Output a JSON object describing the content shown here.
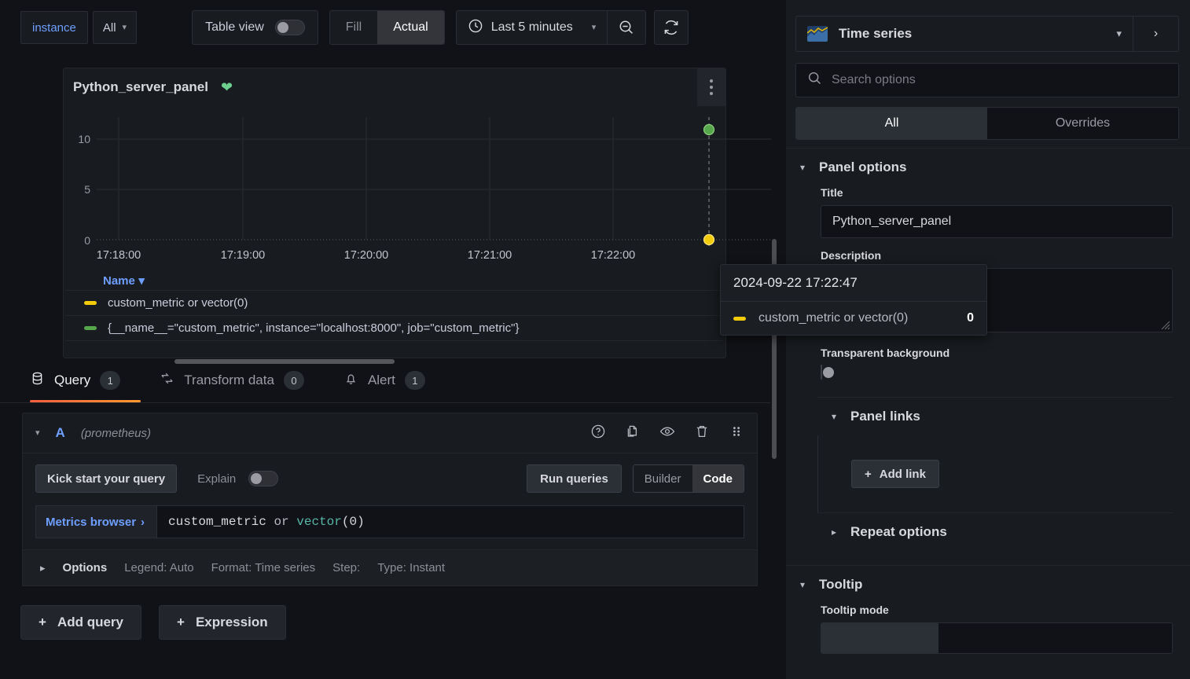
{
  "toolbar": {
    "variable_label": "instance",
    "variable_value": "All",
    "table_view_label": "Table view",
    "table_view_on": false,
    "fill_label": "Fill",
    "actual_label": "Actual",
    "fill_actual_selected": "Actual",
    "time_range": "Last 5 minutes",
    "clock_icon": "clock-icon",
    "zoom_out_icon": "zoom-out-icon",
    "refresh_icon": "refresh-icon",
    "chevron_icon": "chevron-down-icon"
  },
  "panel": {
    "title": "Python_server_panel",
    "health_icon": "heart-icon",
    "health_color": "#6ccf8e",
    "menu_icon": "kebab-menu-icon",
    "legend_sort": "Name",
    "legend": [
      {
        "label": "custom_metric or vector(0)",
        "color": "#f2cc0c"
      },
      {
        "label": "{__name__=\"custom_metric\", instance=\"localhost:8000\", job=\"custom_metric\"}",
        "color": "#56a64b"
      }
    ]
  },
  "chart_data": {
    "type": "scatter",
    "title": "Python_server_panel",
    "xlabel": "",
    "ylabel": "",
    "x_tick_labels": [
      "17:18:00",
      "17:19:00",
      "17:20:00",
      "17:21:00",
      "17:22:00"
    ],
    "y_tick_labels": [
      "0",
      "5",
      "10"
    ],
    "ylim": [
      0,
      12.5
    ],
    "grid": true,
    "legend_position": "bottom",
    "crosshair_time": "17:22:47",
    "series": [
      {
        "name": "custom_metric or vector(0)",
        "color": "#f2cc0c",
        "points": [
          {
            "x": "17:22:47",
            "y": 0
          }
        ]
      },
      {
        "name": "{__name__=\"custom_metric\", instance=\"localhost:8000\", job=\"custom_metric\"}",
        "color": "#56a64b",
        "points": [
          {
            "x": "17:22:47",
            "y": 11
          }
        ]
      }
    ]
  },
  "tooltip": {
    "timestamp": "2024-09-22 17:22:47",
    "series_label": "custom_metric or vector(0)",
    "value": "0",
    "swatch_color": "#f2cc0c"
  },
  "tabs": [
    {
      "label": "Query",
      "badge": "1",
      "icon": "database-icon",
      "active": true
    },
    {
      "label": "Transform data",
      "badge": "0",
      "icon": "transform-icon",
      "active": false
    },
    {
      "label": "Alert",
      "badge": "1",
      "icon": "bell-icon",
      "active": false
    }
  ],
  "query": {
    "ref_id": "A",
    "datasource": "(prometheus)",
    "collapse_icon": "chevron-down-icon",
    "row_icons": [
      "help-circle-icon",
      "duplicate-icon",
      "eye-icon",
      "trash-icon",
      "drag-handle-icon"
    ],
    "kick_start_label": "Kick start your query",
    "explain_label": "Explain",
    "explain_on": false,
    "run_queries_label": "Run queries",
    "builder_label": "Builder",
    "code_label": "Code",
    "editor_mode": "Code",
    "metrics_browser_label": "Metrics browser",
    "expression_tokens": {
      "metric": "custom_metric",
      "operator": "or",
      "function": "vector",
      "args": "(0)"
    },
    "expression_full": "custom_metric or vector(0)",
    "options_label": "Options",
    "options_summary": [
      "Legend: Auto",
      "Format: Time series",
      "Step:",
      "Type: Instant"
    ]
  },
  "footer": {
    "add_query_label": "Add query",
    "expression_label": "Expression",
    "plus_icon": "plus-icon"
  },
  "options_pane": {
    "viz_type": "Time series",
    "viz_icon": "time-series-icon",
    "viz_chevron": "chevron-down-icon",
    "viz_next": "chevron-right-icon",
    "search_placeholder": "Search options",
    "search_icon": "search-icon",
    "segments": [
      {
        "label": "All",
        "active": true
      },
      {
        "label": "Overrides",
        "active": false
      }
    ],
    "sections": {
      "panel_options": {
        "title": "Panel options",
        "title_field_label": "Title",
        "title_field_value": "Python_server_panel",
        "description_field_label": "Description",
        "description_field_value": "",
        "transparent_label": "Transparent background",
        "transparent_on": false
      },
      "panel_links": {
        "title": "Panel links",
        "add_link_label": "Add link"
      },
      "repeat_options": {
        "title": "Repeat options"
      },
      "tooltip": {
        "title": "Tooltip",
        "mode_label": "Tooltip mode"
      }
    }
  }
}
